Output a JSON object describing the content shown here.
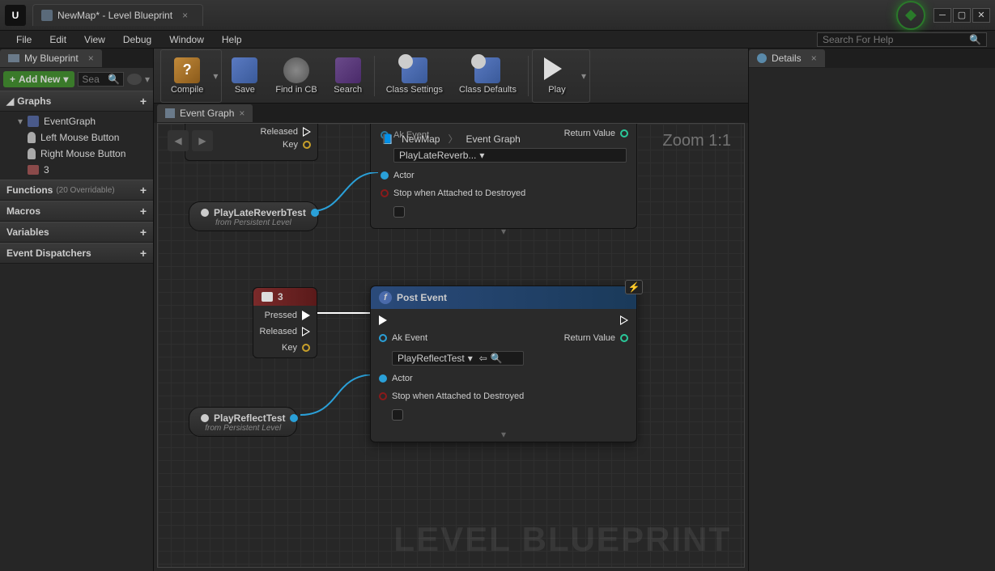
{
  "window": {
    "title": "NewMap* - Level Blueprint"
  },
  "menubar": [
    "File",
    "Edit",
    "View",
    "Debug",
    "Window",
    "Help"
  ],
  "search_help_placeholder": "Search For Help",
  "my_blueprint": {
    "tab_label": "My Blueprint",
    "add_new": "Add New",
    "search_placeholder": "Sea",
    "graphs": {
      "label": "Graphs",
      "root": "EventGraph",
      "children": [
        "Left Mouse Button",
        "Right Mouse Button",
        "3"
      ]
    },
    "functions": {
      "label": "Functions",
      "override_text": "(20 Overridable)"
    },
    "macros": {
      "label": "Macros"
    },
    "variables": {
      "label": "Variables"
    },
    "event_dispatchers": {
      "label": "Event Dispatchers"
    }
  },
  "toolbar": {
    "compile": "Compile",
    "save": "Save",
    "find_in_cb": "Find in CB",
    "search": "Search",
    "class_settings": "Class Settings",
    "class_defaults": "Class Defaults",
    "play": "Play"
  },
  "graph_tab": "Event Graph",
  "breadcrumb": {
    "root": "NewMap",
    "current": "Event Graph"
  },
  "zoom": "Zoom 1:1",
  "watermark": "LEVEL BLUEPRINT",
  "top_partial_node": {
    "released": "Released",
    "key": "Key"
  },
  "ghost_top_node": {
    "ak_event_label": "Ak Event",
    "ak_event_value": "PlayLateReverb...",
    "actor": "Actor",
    "stop_destroyed": "Stop when Attached to Destroyed",
    "return_value": "Return Value"
  },
  "ref_node_1": {
    "name": "PlayLateReverbTest",
    "sub": "from Persistent Level"
  },
  "key_node": {
    "title": "3",
    "pressed": "Pressed",
    "released": "Released",
    "key": "Key"
  },
  "post_event_node": {
    "title": "Post Event",
    "ak_event_label": "Ak Event",
    "ak_event_value": "PlayReflectTest",
    "actor": "Actor",
    "stop_destroyed": "Stop when Attached to Destroyed",
    "return_value": "Return Value"
  },
  "ref_node_2": {
    "name": "PlayReflectTest",
    "sub": "from Persistent Level"
  },
  "details": {
    "tab_label": "Details"
  }
}
